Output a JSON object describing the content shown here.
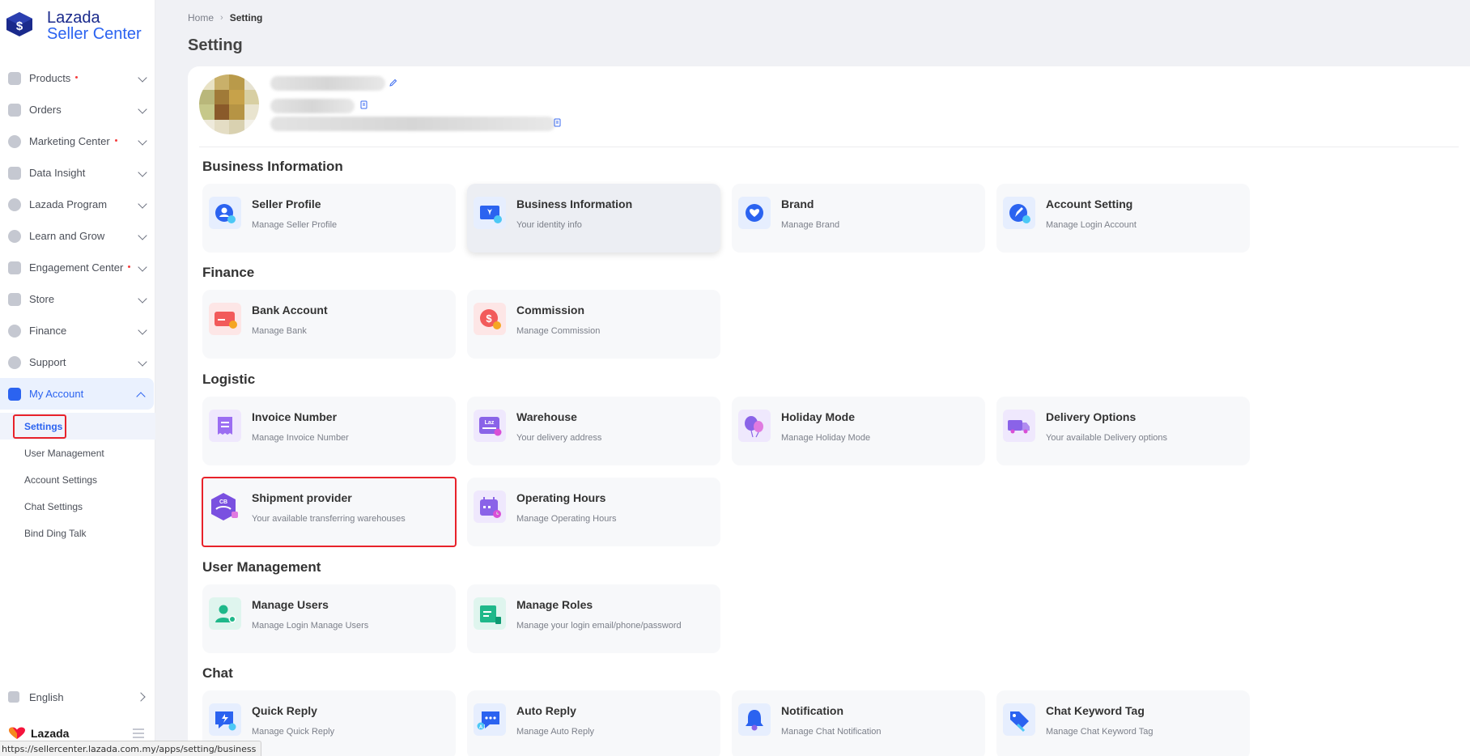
{
  "brand": {
    "line1": "Lazada",
    "line2": "Seller Center",
    "footer": "Lazada"
  },
  "sidebar": {
    "items": [
      {
        "label": "Products",
        "dot": true
      },
      {
        "label": "Orders",
        "dot": false
      },
      {
        "label": "Marketing Center",
        "dot": true
      },
      {
        "label": "Data Insight",
        "dot": false
      },
      {
        "label": "Lazada Program",
        "dot": false
      },
      {
        "label": "Learn and Grow",
        "dot": false
      },
      {
        "label": "Engagement Center",
        "dot": true
      },
      {
        "label": "Store",
        "dot": false
      },
      {
        "label": "Finance",
        "dot": false
      },
      {
        "label": "Support",
        "dot": false
      },
      {
        "label": "My Account",
        "dot": false
      }
    ],
    "sub_items": [
      "Settings",
      "User Management",
      "Account Settings",
      "Chat Settings",
      "Bind Ding Talk"
    ],
    "language": "English"
  },
  "status_url": "https://sellercenter.lazada.com.my/apps/setting/business",
  "breadcrumb": {
    "home": "Home",
    "current": "Setting"
  },
  "page_title": "Setting",
  "sections": [
    {
      "title": "Business Information",
      "cards": [
        {
          "title": "Seller Profile",
          "subtitle": "Manage Seller Profile",
          "icon": "seller-profile-icon"
        },
        {
          "title": "Business Information",
          "subtitle": "Your identity info",
          "icon": "business-info-icon"
        },
        {
          "title": "Brand",
          "subtitle": "Manage Brand",
          "icon": "brand-icon"
        },
        {
          "title": "Account Setting",
          "subtitle": "Manage Login Account",
          "icon": "account-setting-icon"
        }
      ]
    },
    {
      "title": "Finance",
      "cards": [
        {
          "title": "Bank Account",
          "subtitle": "Manage Bank",
          "icon": "bank-card-icon"
        },
        {
          "title": "Commission",
          "subtitle": "Manage Commission",
          "icon": "commission-icon"
        }
      ]
    },
    {
      "title": "Logistic",
      "cards": [
        {
          "title": "Invoice Number",
          "subtitle": "Manage Invoice Number",
          "icon": "invoice-icon"
        },
        {
          "title": "Warehouse",
          "subtitle": "Your delivery address",
          "icon": "warehouse-icon"
        },
        {
          "title": "Holiday Mode",
          "subtitle": "Manage Holiday Mode",
          "icon": "holiday-balloon-icon"
        },
        {
          "title": "Delivery Options",
          "subtitle": "Your available Delivery options",
          "icon": "delivery-truck-icon"
        },
        {
          "title": "Shipment provider",
          "subtitle": "Your available transferring warehouses",
          "icon": "shipment-provider-icon"
        },
        {
          "title": "Operating Hours",
          "subtitle": "Manage Operating Hours",
          "icon": "calendar-clock-icon"
        }
      ]
    },
    {
      "title": "User Management",
      "cards": [
        {
          "title": "Manage Users",
          "subtitle": "Manage Login Manage Users",
          "icon": "manage-users-icon"
        },
        {
          "title": "Manage Roles",
          "subtitle": "Manage your login email/phone/password",
          "icon": "manage-roles-icon"
        }
      ]
    },
    {
      "title": "Chat",
      "cards": [
        {
          "title": "Quick Reply",
          "subtitle": "Manage Quick Reply",
          "icon": "quick-reply-icon"
        },
        {
          "title": "Auto Reply",
          "subtitle": "Manage Auto Reply",
          "icon": "auto-reply-icon"
        },
        {
          "title": "Notification",
          "subtitle": "Manage Chat Notification",
          "icon": "bell-icon"
        },
        {
          "title": "Chat Keyword Tag",
          "subtitle": "Manage Chat Keyword Tag",
          "icon": "keyword-tag-icon"
        }
      ]
    }
  ],
  "colors": {
    "accent": "#2b63f0",
    "highlight": "#e8222a",
    "card_bg": "#f7f8fa"
  }
}
